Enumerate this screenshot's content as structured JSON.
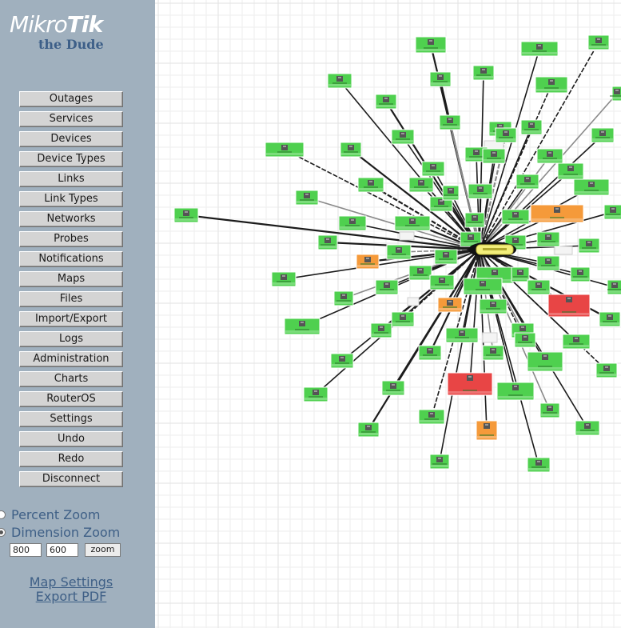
{
  "brand": {
    "name_light": "Mikro",
    "name_bold": "Tik",
    "product": "the Dude"
  },
  "menu": [
    "Outages",
    "Services",
    "Devices",
    "Device Types",
    "Links",
    "Link Types",
    "Networks",
    "Probes",
    "Notifications",
    "Maps",
    "Files",
    "Import/Export",
    "Logs",
    "Administration",
    "Charts",
    "RouterOS",
    "Settings",
    "Undo",
    "Redo",
    "Disconnect"
  ],
  "zoom": {
    "percent_label": "Percent Zoom",
    "dimension_label": "Dimension Zoom",
    "selected": "dimension",
    "width": "800",
    "height": "600",
    "button": "zoom"
  },
  "links": {
    "map_settings": "Map Settings",
    "export_pdf": "Export PDF"
  },
  "map": {
    "status_colors": {
      "up": "#4fd04f",
      "partial": "#f59a3a",
      "down": "#e84545",
      "hub": "#f2ee7a"
    },
    "device_status_counts": {
      "up": 95,
      "partial": 5,
      "down": 2
    },
    "device_icon": "server-icon"
  }
}
